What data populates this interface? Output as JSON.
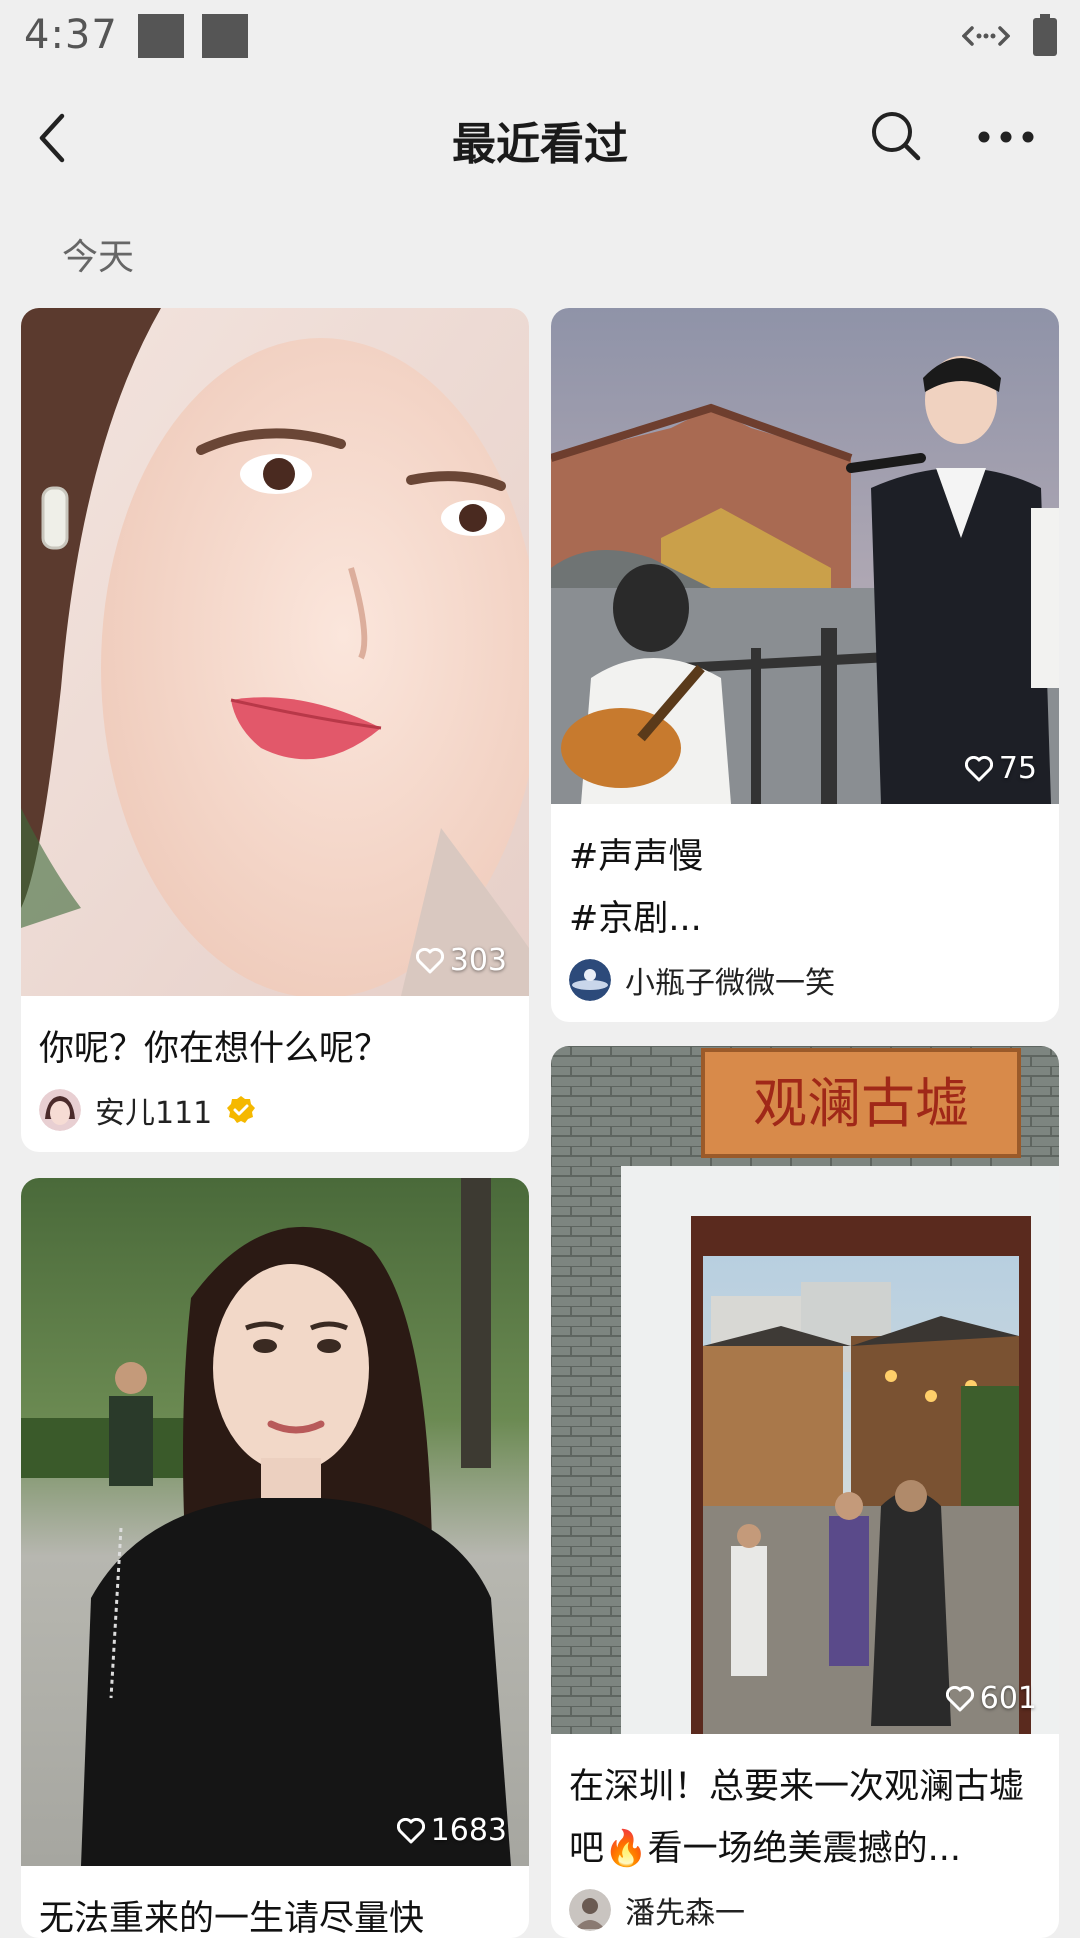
{
  "status_bar": {
    "time": "4:37"
  },
  "header": {
    "title": "最近看过"
  },
  "section": {
    "label": "今天"
  },
  "cards": [
    {
      "title": "你呢？你在想什么呢？",
      "likes": "303",
      "author": "安儿111",
      "verified": true
    },
    {
      "title": "#声声慢\n#京剧...",
      "likes": "75",
      "author": "小瓶子微微一笑"
    },
    {
      "title": "无法重来的一生请尽量快",
      "likes": "1683",
      "author": ""
    },
    {
      "title": "在深圳！总要来一次观澜古墟吧🔥看一场绝美震撼的...",
      "likes": "601",
      "author": "潘先森一",
      "sign_text": "观澜古墟"
    }
  ],
  "icons": {
    "back": "chevron-left-icon",
    "search": "search-icon",
    "more": "more-dots-icon",
    "like": "heart-outline-icon",
    "verified": "verified-badge-icon"
  },
  "colors": {
    "background": "#efefef",
    "card": "#ffffff",
    "verified": "#f5b800"
  }
}
